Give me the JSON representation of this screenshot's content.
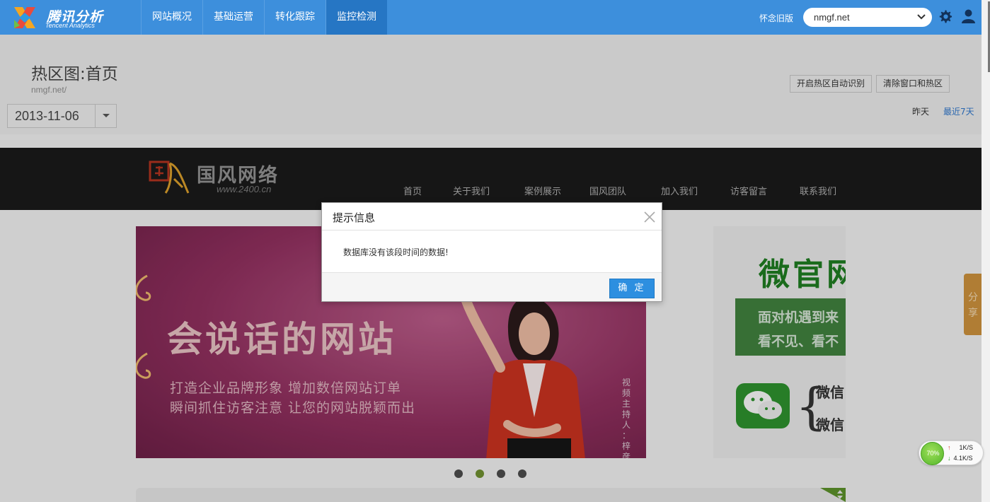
{
  "brand": {
    "cn": "腾讯分析",
    "en": "Tencent Analytics"
  },
  "nav": [
    {
      "label": "网站概况",
      "active": false
    },
    {
      "label": "基础运营",
      "active": false
    },
    {
      "label": "转化跟踪",
      "active": false
    },
    {
      "label": "监控检测",
      "active": true
    }
  ],
  "header_right": {
    "old_version": "怀念旧版",
    "site_selected": "nmgf.net"
  },
  "page": {
    "title": "热区图:首页",
    "url": "nmgf.net/",
    "date": "2013-11-06",
    "btn_auto_detect": "开启热区自动识别",
    "btn_clear": "清除窗口和热区",
    "range_yesterday": "昨天",
    "range_7days": "最近7天"
  },
  "preview": {
    "logo_cn": "国风网络",
    "logo_url": "www.2400.cn",
    "nav": [
      "首页",
      "关于我们",
      "案例展示",
      "国风团队",
      "加入我们",
      "访客留言",
      "联系我们"
    ],
    "banner_title": "会说话的网站",
    "banner_sub1": "打造企业品牌形象 增加数倍网站订单",
    "banner_sub2": "瞬间抓住访客注意 让您的网站脱颖而出",
    "banner_vertical": "视频主持人：梓彦",
    "side_title": "微官网",
    "side_line1": "面对机遇到来",
    "side_line2": "看不见、看不",
    "side_wx1": "微信",
    "side_wx2": "微信",
    "share": "分享",
    "slide_count": 4,
    "slide_active": 2
  },
  "modal": {
    "title": "提示信息",
    "message": "数据库没有该段时间的数据!",
    "ok": "确 定"
  },
  "speed": {
    "percent": "70%",
    "up": "1K/S",
    "down": "4.1K/S"
  },
  "colors": {
    "topbar": "#3d8fdc",
    "nav_active": "#2676c4",
    "ok_button": "#2d8fe0",
    "link": "#2f75c8"
  }
}
